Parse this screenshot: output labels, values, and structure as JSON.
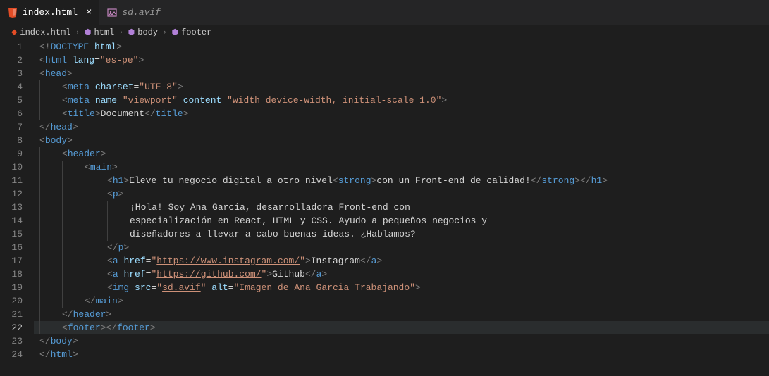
{
  "tabs": [
    {
      "name": "index.html",
      "active": true,
      "iconColor": "#e44d26"
    },
    {
      "name": "sd.avif",
      "active": false,
      "iconColor": "#c586c0"
    }
  ],
  "breadcrumbs": {
    "file": "index.html",
    "path": [
      "html",
      "body",
      "footer"
    ]
  },
  "activeLine": 22,
  "lines": [
    {
      "indent": 0,
      "tokens": [
        {
          "t": "<!",
          "c": "c-punct"
        },
        {
          "t": "DOCTYPE",
          "c": "c-tag"
        },
        {
          "t": " ",
          "c": "c-text"
        },
        {
          "t": "html",
          "c": "c-attr"
        },
        {
          "t": ">",
          "c": "c-punct"
        }
      ]
    },
    {
      "indent": 0,
      "tokens": [
        {
          "t": "<",
          "c": "c-punct"
        },
        {
          "t": "html",
          "c": "c-tag"
        },
        {
          "t": " ",
          "c": "c-text"
        },
        {
          "t": "lang",
          "c": "c-attr"
        },
        {
          "t": "=",
          "c": "c-text"
        },
        {
          "t": "\"es-pe\"",
          "c": "c-string"
        },
        {
          "t": ">",
          "c": "c-punct"
        }
      ]
    },
    {
      "indent": 0,
      "tokens": [
        {
          "t": "<",
          "c": "c-punct"
        },
        {
          "t": "head",
          "c": "c-tag"
        },
        {
          "t": ">",
          "c": "c-punct"
        }
      ]
    },
    {
      "indent": 1,
      "tokens": [
        {
          "t": "<",
          "c": "c-punct"
        },
        {
          "t": "meta",
          "c": "c-tag"
        },
        {
          "t": " ",
          "c": "c-text"
        },
        {
          "t": "charset",
          "c": "c-attr"
        },
        {
          "t": "=",
          "c": "c-text"
        },
        {
          "t": "\"UTF-8\"",
          "c": "c-string"
        },
        {
          "t": ">",
          "c": "c-punct"
        }
      ]
    },
    {
      "indent": 1,
      "tokens": [
        {
          "t": "<",
          "c": "c-punct"
        },
        {
          "t": "meta",
          "c": "c-tag"
        },
        {
          "t": " ",
          "c": "c-text"
        },
        {
          "t": "name",
          "c": "c-attr"
        },
        {
          "t": "=",
          "c": "c-text"
        },
        {
          "t": "\"viewport\"",
          "c": "c-string"
        },
        {
          "t": " ",
          "c": "c-text"
        },
        {
          "t": "content",
          "c": "c-attr"
        },
        {
          "t": "=",
          "c": "c-text"
        },
        {
          "t": "\"width=device-width, initial-scale=1.0\"",
          "c": "c-string"
        },
        {
          "t": ">",
          "c": "c-punct"
        }
      ]
    },
    {
      "indent": 1,
      "tokens": [
        {
          "t": "<",
          "c": "c-punct"
        },
        {
          "t": "title",
          "c": "c-tag"
        },
        {
          "t": ">",
          "c": "c-punct"
        },
        {
          "t": "Document",
          "c": "c-text"
        },
        {
          "t": "</",
          "c": "c-punct"
        },
        {
          "t": "title",
          "c": "c-tag"
        },
        {
          "t": ">",
          "c": "c-punct"
        }
      ]
    },
    {
      "indent": 0,
      "tokens": [
        {
          "t": "</",
          "c": "c-punct"
        },
        {
          "t": "head",
          "c": "c-tag"
        },
        {
          "t": ">",
          "c": "c-punct"
        }
      ]
    },
    {
      "indent": 0,
      "tokens": [
        {
          "t": "<",
          "c": "c-punct"
        },
        {
          "t": "body",
          "c": "c-tag"
        },
        {
          "t": ">",
          "c": "c-punct"
        }
      ]
    },
    {
      "indent": 1,
      "tokens": [
        {
          "t": "<",
          "c": "c-punct"
        },
        {
          "t": "header",
          "c": "c-tag"
        },
        {
          "t": ">",
          "c": "c-punct"
        }
      ]
    },
    {
      "indent": 2,
      "tokens": [
        {
          "t": "<",
          "c": "c-punct"
        },
        {
          "t": "main",
          "c": "c-tag"
        },
        {
          "t": ">",
          "c": "c-punct"
        }
      ]
    },
    {
      "indent": 3,
      "tokens": [
        {
          "t": "<",
          "c": "c-punct"
        },
        {
          "t": "h1",
          "c": "c-tag"
        },
        {
          "t": ">",
          "c": "c-punct"
        },
        {
          "t": "Eleve tu negocio digital a otro nivel",
          "c": "c-text"
        },
        {
          "t": "<",
          "c": "c-punct"
        },
        {
          "t": "strong",
          "c": "c-tag"
        },
        {
          "t": ">",
          "c": "c-punct"
        },
        {
          "t": "con un Front-end de calidad!",
          "c": "c-text"
        },
        {
          "t": "</",
          "c": "c-punct"
        },
        {
          "t": "strong",
          "c": "c-tag"
        },
        {
          "t": ">",
          "c": "c-punct"
        },
        {
          "t": "</",
          "c": "c-punct"
        },
        {
          "t": "h1",
          "c": "c-tag"
        },
        {
          "t": ">",
          "c": "c-punct"
        }
      ]
    },
    {
      "indent": 3,
      "tokens": [
        {
          "t": "<",
          "c": "c-punct"
        },
        {
          "t": "p",
          "c": "c-tag"
        },
        {
          "t": ">",
          "c": "c-punct"
        }
      ]
    },
    {
      "indent": 4,
      "tokens": [
        {
          "t": "¡Hola! Soy Ana García, desarrolladora Front-end con",
          "c": "c-text"
        }
      ]
    },
    {
      "indent": 4,
      "tokens": [
        {
          "t": "especialización en React, HTML y CSS. Ayudo a pequeños negocios y",
          "c": "c-text"
        }
      ]
    },
    {
      "indent": 4,
      "tokens": [
        {
          "t": "diseñadores a llevar a cabo buenas ideas. ¿Hablamos?",
          "c": "c-text"
        }
      ]
    },
    {
      "indent": 3,
      "tokens": [
        {
          "t": "</",
          "c": "c-punct"
        },
        {
          "t": "p",
          "c": "c-tag"
        },
        {
          "t": ">",
          "c": "c-punct"
        }
      ]
    },
    {
      "indent": 3,
      "tokens": [
        {
          "t": "<",
          "c": "c-punct"
        },
        {
          "t": "a",
          "c": "c-tag"
        },
        {
          "t": " ",
          "c": "c-text"
        },
        {
          "t": "href",
          "c": "c-attr"
        },
        {
          "t": "=",
          "c": "c-text"
        },
        {
          "t": "\"",
          "c": "c-string"
        },
        {
          "t": "https://www.instagram.com/",
          "c": "c-string underline"
        },
        {
          "t": "\"",
          "c": "c-string"
        },
        {
          "t": ">",
          "c": "c-punct"
        },
        {
          "t": "Instagram",
          "c": "c-text"
        },
        {
          "t": "</",
          "c": "c-punct"
        },
        {
          "t": "a",
          "c": "c-tag"
        },
        {
          "t": ">",
          "c": "c-punct"
        }
      ]
    },
    {
      "indent": 3,
      "tokens": [
        {
          "t": "<",
          "c": "c-punct"
        },
        {
          "t": "a",
          "c": "c-tag"
        },
        {
          "t": " ",
          "c": "c-text"
        },
        {
          "t": "href",
          "c": "c-attr"
        },
        {
          "t": "=",
          "c": "c-text"
        },
        {
          "t": "\"",
          "c": "c-string"
        },
        {
          "t": "https://github.com/",
          "c": "c-string underline"
        },
        {
          "t": "\"",
          "c": "c-string"
        },
        {
          "t": ">",
          "c": "c-punct"
        },
        {
          "t": "Github",
          "c": "c-text"
        },
        {
          "t": "</",
          "c": "c-punct"
        },
        {
          "t": "a",
          "c": "c-tag"
        },
        {
          "t": ">",
          "c": "c-punct"
        }
      ]
    },
    {
      "indent": 3,
      "tokens": [
        {
          "t": "<",
          "c": "c-punct"
        },
        {
          "t": "img",
          "c": "c-tag"
        },
        {
          "t": " ",
          "c": "c-text"
        },
        {
          "t": "src",
          "c": "c-attr"
        },
        {
          "t": "=",
          "c": "c-text"
        },
        {
          "t": "\"",
          "c": "c-string"
        },
        {
          "t": "sd.avif",
          "c": "c-string underline"
        },
        {
          "t": "\"",
          "c": "c-string"
        },
        {
          "t": " ",
          "c": "c-text"
        },
        {
          "t": "alt",
          "c": "c-attr"
        },
        {
          "t": "=",
          "c": "c-text"
        },
        {
          "t": "\"Imagen de Ana Garcia Trabajando\"",
          "c": "c-string"
        },
        {
          "t": ">",
          "c": "c-punct"
        }
      ]
    },
    {
      "indent": 2,
      "tokens": [
        {
          "t": "</",
          "c": "c-punct"
        },
        {
          "t": "main",
          "c": "c-tag"
        },
        {
          "t": ">",
          "c": "c-punct"
        }
      ]
    },
    {
      "indent": 1,
      "tokens": [
        {
          "t": "</",
          "c": "c-punct"
        },
        {
          "t": "header",
          "c": "c-tag"
        },
        {
          "t": ">",
          "c": "c-punct"
        }
      ]
    },
    {
      "indent": 1,
      "tokens": [
        {
          "t": "<",
          "c": "c-punct"
        },
        {
          "t": "footer",
          "c": "c-tag"
        },
        {
          "t": ">",
          "c": "c-punct"
        },
        {
          "t": "</",
          "c": "c-punct"
        },
        {
          "t": "footer",
          "c": "c-tag"
        },
        {
          "t": ">",
          "c": "c-punct"
        }
      ]
    },
    {
      "indent": 0,
      "tokens": [
        {
          "t": "</",
          "c": "c-punct"
        },
        {
          "t": "body",
          "c": "c-tag"
        },
        {
          "t": ">",
          "c": "c-punct"
        }
      ]
    },
    {
      "indent": 0,
      "tokens": [
        {
          "t": "</",
          "c": "c-punct"
        },
        {
          "t": "html",
          "c": "c-tag"
        },
        {
          "t": ">",
          "c": "c-punct"
        }
      ]
    }
  ]
}
